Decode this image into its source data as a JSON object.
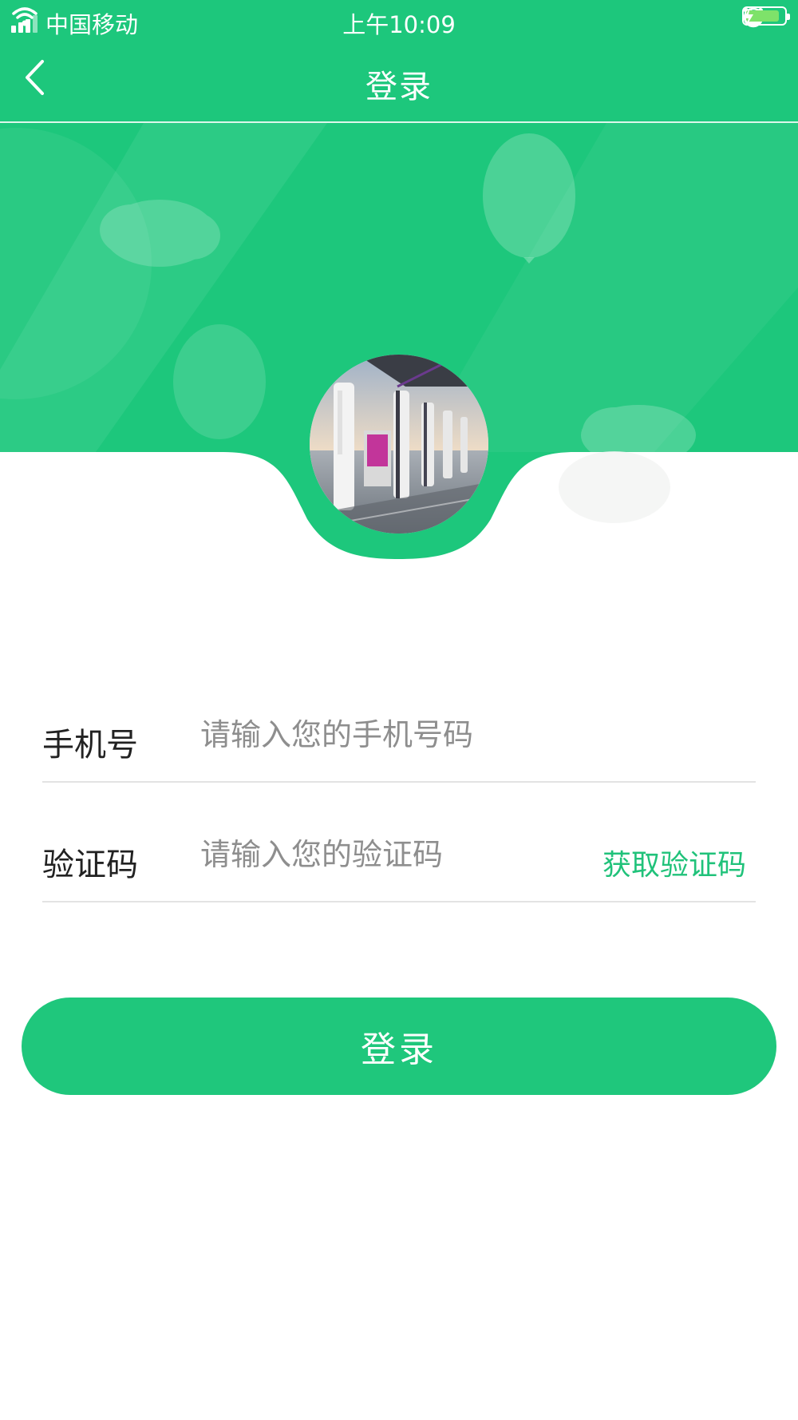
{
  "status_bar": {
    "carrier": "中国移动",
    "time": "上午10:09",
    "battery_level": 0.9
  },
  "nav": {
    "title": "登录",
    "back_icon": "chevron-left-icon"
  },
  "colors": {
    "brand_green": "#1fc77c",
    "link_green": "#20c27a",
    "divider": "#e3e3e3"
  },
  "form": {
    "phone": {
      "label": "手机号",
      "placeholder": "请输入您的手机号码",
      "value": ""
    },
    "code": {
      "label": "验证码",
      "placeholder": "请输入您的验证码",
      "value": "",
      "get_code_label": "获取验证码"
    }
  },
  "login_button": {
    "label": "登录"
  }
}
